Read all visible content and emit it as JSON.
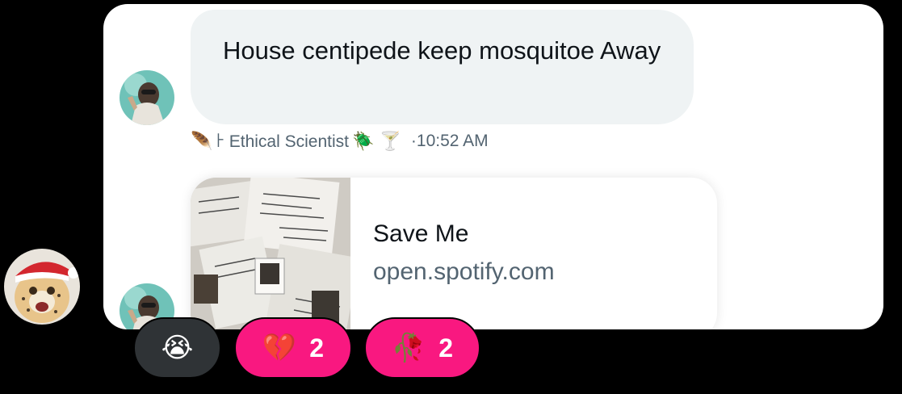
{
  "message": {
    "text": "House centipede keep mosquitoe Away"
  },
  "sender": {
    "prefix_glyph": "🪶",
    "name": "𐀅 Ethical Scientist",
    "suffix_glyphs": "🪲 🍸",
    "separator": "·",
    "time": "10:52 AM"
  },
  "link_card": {
    "title": "Save Me",
    "domain": "open.spotify.com"
  },
  "reactions": [
    {
      "emoji": "😭",
      "count": ""
    },
    {
      "emoji": "💔",
      "count": "2"
    },
    {
      "emoji": "🥀",
      "count": "2"
    }
  ],
  "colors": {
    "background": "#000000",
    "card": "#ffffff",
    "bubble": "#eff3f4",
    "reaction_dark": "#2f3336",
    "reaction_pink": "#f91880",
    "secondary_text": "#536471"
  }
}
